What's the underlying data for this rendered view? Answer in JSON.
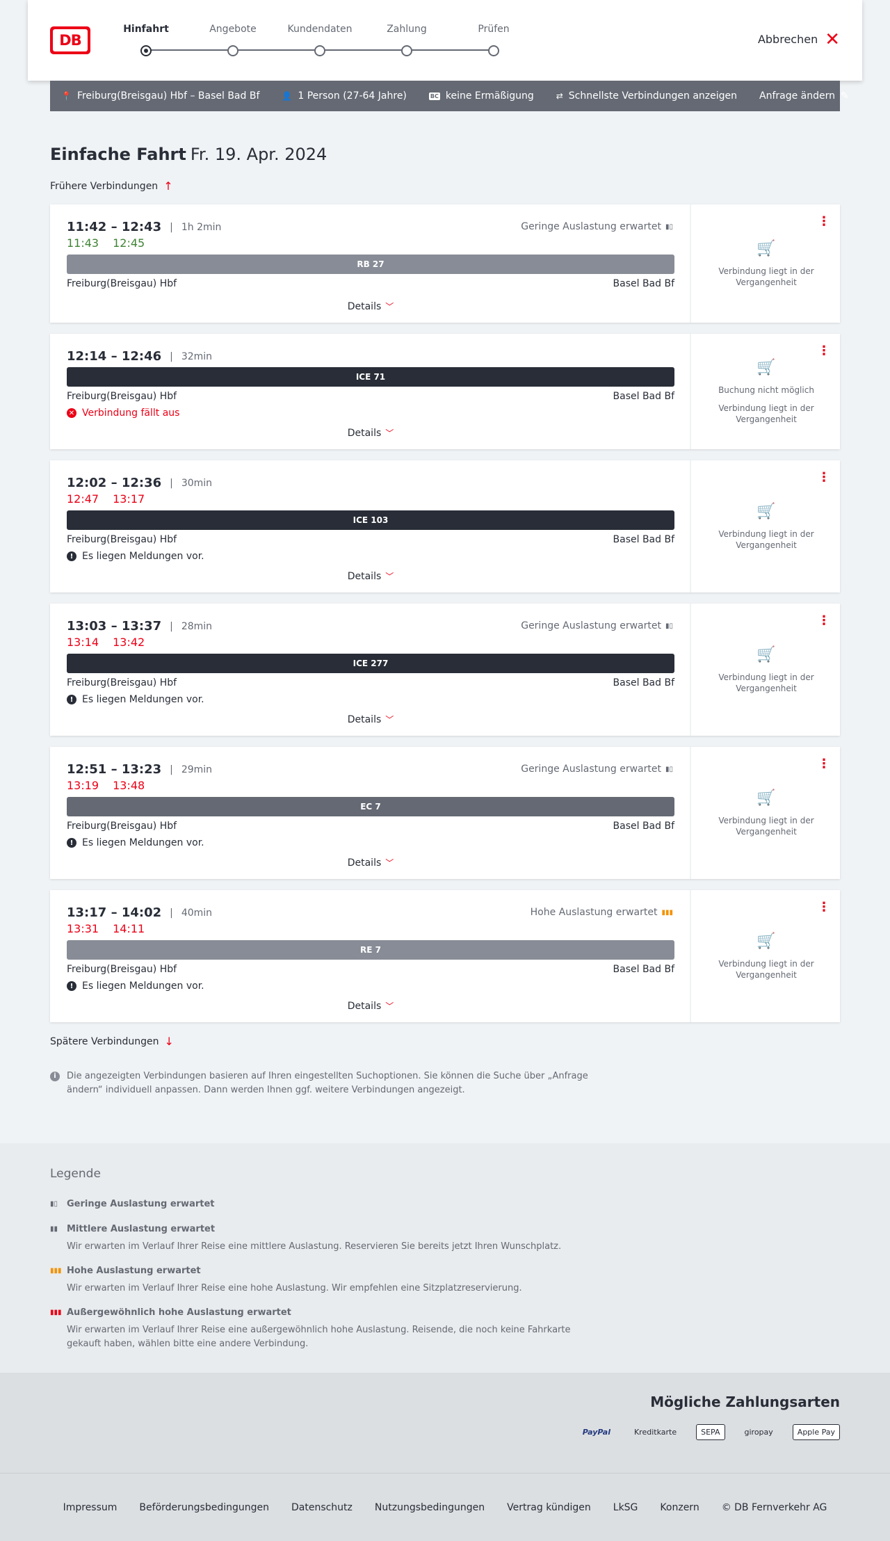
{
  "header": {
    "logo_text": "DB",
    "steps": [
      "Hinfahrt",
      "Angebote",
      "Kundendaten",
      "Zahlung",
      "Prüfen"
    ],
    "cancel_label": "Abbrechen"
  },
  "summary": {
    "route": "Freiburg(Breisgau) Hbf – Basel Bad Bf",
    "travellers": "1 Person (27-64 Jahre)",
    "bc_badge": "BC",
    "discount": "keine Ermäßigung",
    "fastest": "Schnellste Verbindungen anzeigen",
    "change": "Anfrage ändern"
  },
  "page": {
    "title_bold": "Einfache Fahrt",
    "title_date": "Fr. 19. Apr. 2024",
    "earlier": "Frühere Verbindungen",
    "later": "Spätere Verbindungen",
    "details_label": "Details",
    "info": "Die angezeigten Verbindungen basieren auf Ihren eingestellten Suchoptionen. Sie können die Suche über „Anfrage ändern“ individuell anpassen. Dann werden Ihnen ggf. weitere Verbindungen angezeigt."
  },
  "connections": [
    {
      "times": "11:42 – 12:43",
      "duration": "1h 2min",
      "load": "Geringe Auslastung erwartet",
      "rt_dep": "11:43",
      "rt_arr": "12:45",
      "train": "RB 27",
      "from": "Freiburg(Breisgau) Hbf",
      "to": "Basel Bad Bf",
      "message": "",
      "side_note": "Verbindung liegt in der Vergangenheit",
      "side_note2": ""
    },
    {
      "times": "12:14 – 12:46",
      "duration": "32min",
      "load": "",
      "rt_dep": "",
      "rt_arr": "",
      "train": "ICE 71",
      "from": "Freiburg(Breisgau) Hbf",
      "to": "Basel Bad Bf",
      "message": "Verbindung fällt aus",
      "side_note": "Buchung nicht möglich",
      "side_note2": "Verbindung liegt in der Vergangenheit"
    },
    {
      "times": "12:02 – 12:36",
      "duration": "30min",
      "load": "",
      "rt_dep": "12:47",
      "rt_arr": "13:17",
      "train": "ICE 103",
      "from": "Freiburg(Breisgau) Hbf",
      "to": "Basel Bad Bf",
      "message": "Es liegen Meldungen vor.",
      "side_note": "Verbindung liegt in der Vergangenheit",
      "side_note2": ""
    },
    {
      "times": "13:03 – 13:37",
      "duration": "28min",
      "load": "Geringe Auslastung erwartet",
      "rt_dep": "13:14",
      "rt_arr": "13:42",
      "train": "ICE 277",
      "from": "Freiburg(Breisgau) Hbf",
      "to": "Basel Bad Bf",
      "message": "Es liegen Meldungen vor.",
      "side_note": "Verbindung liegt in der Vergangenheit",
      "side_note2": ""
    },
    {
      "times": "12:51 – 13:23",
      "duration": "29min",
      "load": "Geringe Auslastung erwartet",
      "rt_dep": "13:19",
      "rt_arr": "13:48",
      "train": "EC 7",
      "from": "Freiburg(Breisgau) Hbf",
      "to": "Basel Bad Bf",
      "message": "Es liegen Meldungen vor.",
      "side_note": "Verbindung liegt in der Vergangenheit",
      "side_note2": ""
    },
    {
      "times": "13:17 – 14:02",
      "duration": "40min",
      "load": "Hohe Auslastung erwartet",
      "rt_dep": "13:31",
      "rt_arr": "14:11",
      "train": "RE 7",
      "from": "Freiburg(Breisgau) Hbf",
      "to": "Basel Bad Bf",
      "message": "Es liegen Meldungen vor.",
      "side_note": "Verbindung liegt in der Vergangenheit",
      "side_note2": ""
    }
  ],
  "legend": {
    "title": "Legende",
    "items": [
      {
        "head": "Geringe Auslastung erwartet",
        "body": ""
      },
      {
        "head": "Mittlere Auslastung erwartet",
        "body": "Wir erwarten im Verlauf Ihrer Reise eine mittlere Auslastung. Reservieren Sie bereits jetzt Ihren Wunschplatz."
      },
      {
        "head": "Hohe Auslastung erwartet",
        "body": "Wir erwarten im Verlauf Ihrer Reise eine hohe Auslastung. Wir empfehlen eine Sitzplatzreservierung."
      },
      {
        "head": "Außergewöhnlich hohe Auslastung erwartet",
        "body": "Wir erwarten im Verlauf Ihrer Reise eine außergewöhnlich hohe Auslastung. Reisende, die noch keine Fahrkarte gekauft haben, wählen bitte eine andere Verbindung."
      }
    ]
  },
  "payment": {
    "title": "Mögliche Zahlungsarten",
    "methods": [
      "PayPal",
      "Kreditkarte",
      "SEPA",
      "giropay",
      "Apple Pay"
    ]
  },
  "footer": {
    "links": [
      "Impressum",
      "Beförderungsbedingungen",
      "Datenschutz",
      "Nutzungsbedingungen",
      "Vertrag kündigen",
      "LkSG",
      "Konzern",
      "© DB Fernverkehr AG"
    ]
  },
  "colors": {
    "brand": "#ec0016",
    "ontime": "#408335",
    "high_load": "#f39200"
  }
}
